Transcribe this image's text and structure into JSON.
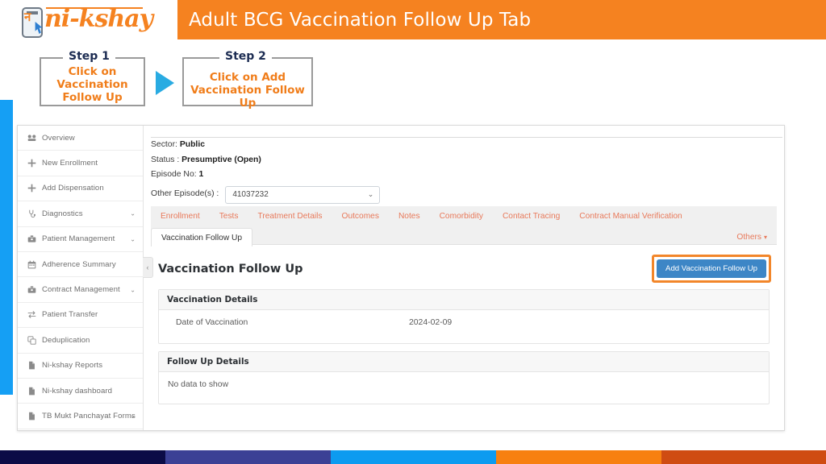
{
  "slide": {
    "header_title": "Adult BCG Vaccination Follow Up Tab",
    "header_color": "#f58220",
    "logo": {
      "word": "ni-kshay",
      "device_glyph": "न"
    },
    "steps": [
      {
        "legend": "Step 1",
        "text": "Click on\nVaccination\nFollow Up"
      },
      {
        "legend": "Step 2",
        "text": "Click on Add\nVaccination Follow Up"
      }
    ],
    "arrow_icon": "play-triangle-icon",
    "rail_color": "#159ff4",
    "footer_colors": [
      "#0b0b46",
      "#3b4095",
      "#0d9bf0",
      "#f78010",
      "#cf4c12"
    ]
  },
  "app": {
    "sidebar": {
      "collapse_label": "‹",
      "items": [
        {
          "label": "Overview",
          "icon": "dashboard-icon",
          "caret": ""
        },
        {
          "label": "New Enrollment",
          "icon": "plus-icon",
          "caret": ""
        },
        {
          "label": "Add Dispensation",
          "icon": "plus-icon",
          "caret": ""
        },
        {
          "label": "Diagnostics",
          "icon": "stethoscope-icon",
          "caret": "⌄"
        },
        {
          "label": "Patient Management",
          "icon": "briefcase-icon",
          "caret": "⌄"
        },
        {
          "label": "Adherence Summary",
          "icon": "calendar-icon",
          "caret": ""
        },
        {
          "label": "Contract Management",
          "icon": "briefcase-icon",
          "caret": "⌄"
        },
        {
          "label": "Patient Transfer",
          "icon": "transfer-icon",
          "caret": ""
        },
        {
          "label": "Deduplication",
          "icon": "copy-icon",
          "caret": ""
        },
        {
          "label": "Ni-kshay Reports",
          "icon": "document-icon",
          "caret": ""
        },
        {
          "label": "Ni-kshay dashboard",
          "icon": "document-icon",
          "caret": ""
        },
        {
          "label": "TB Mukt Panchayat Forms",
          "icon": "document-icon",
          "caret": "⌄"
        }
      ]
    },
    "patient": {
      "sector_label": "Sector:",
      "sector_value": "Public",
      "status_label": "Status :",
      "status_value": "Presumptive (Open)",
      "episode_label": "Episode No:",
      "episode_value": "1",
      "other_episodes_label": "Other Episode(s) :",
      "other_episodes_value": "41037232",
      "select_caret": "⌄"
    },
    "tabs": [
      {
        "label": "Enrollment",
        "active": false,
        "dropdown": false
      },
      {
        "label": "Tests",
        "active": false,
        "dropdown": false
      },
      {
        "label": "Treatment Details",
        "active": false,
        "dropdown": false
      },
      {
        "label": "Outcomes",
        "active": false,
        "dropdown": false
      },
      {
        "label": "Notes",
        "active": false,
        "dropdown": false
      },
      {
        "label": "Comorbidity",
        "active": false,
        "dropdown": false
      },
      {
        "label": "Contact Tracing",
        "active": false,
        "dropdown": false
      },
      {
        "label": "Contract Manual Verification",
        "active": false,
        "dropdown": false
      },
      {
        "label": "Vaccination Follow Up",
        "active": true,
        "dropdown": false
      },
      {
        "label": "Others",
        "active": false,
        "dropdown": true
      }
    ],
    "content": {
      "title": "Vaccination Follow Up",
      "add_button_label": "Add Vaccination Follow Up",
      "add_button_color": "#3d86c6",
      "highlight_color": "#f2862a",
      "vaccination_panel": {
        "heading": "Vaccination Details",
        "rows": [
          {
            "key": "Date of Vaccination",
            "value": "2024-02-09"
          }
        ]
      },
      "followup_panel": {
        "heading": "Follow Up Details",
        "empty_message": "No data to show"
      }
    }
  }
}
